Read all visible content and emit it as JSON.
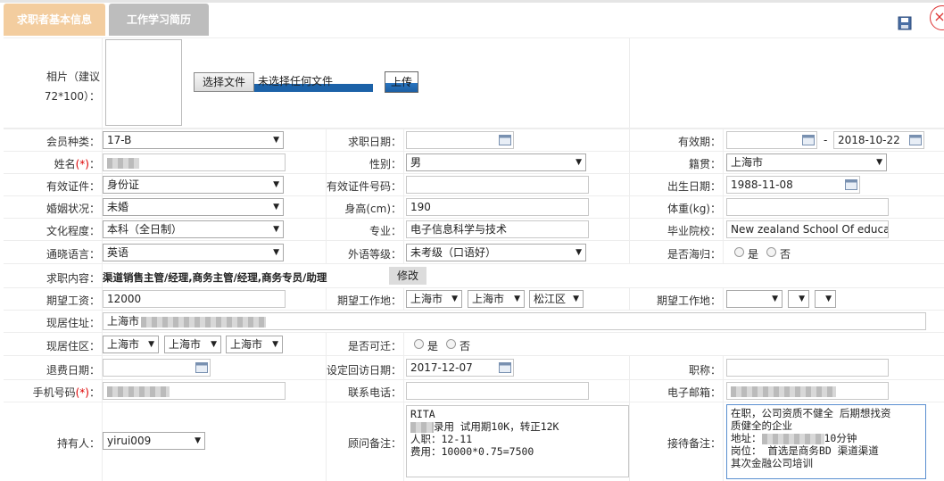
{
  "tabs": [
    {
      "label": "求职者基本信息"
    },
    {
      "label": "工作学习简历"
    }
  ],
  "photo": {
    "label_line1": "相片（建议",
    "label_line2": "72*100）：",
    "choose_file": "选择文件",
    "no_file": "未选择任何文件",
    "upload": "上传"
  },
  "labels": {
    "member_type": "会员种类：",
    "apply_date": "求职日期：",
    "valid_period": "有效期：",
    "dash": "-",
    "name": "姓名",
    "req": "(*)",
    "colon": "：",
    "gender": "性别：",
    "native": "籍贯：",
    "id_type": "有效证件：",
    "id_no": "有效证件号码：",
    "birth": "出生日期：",
    "marital": "婚姻状况：",
    "height": "身高(cm)：",
    "weight": "体重(kg)：",
    "education": "文化程度：",
    "major": "专业：",
    "school": "毕业院校：",
    "language": "通晓语言：",
    "foreign_level": "外语等级：",
    "overseas": "是否海归：",
    "job_content": "求职内容：",
    "modify": "修改",
    "salary": "期望工资：",
    "work_place": "期望工作地：",
    "work_place2": "期望工作地：",
    "address": "现居住址：",
    "district": "现居住区：",
    "relocate": "是否可迁：",
    "refund_date": "退费日期：",
    "revisit_date": "设定回访日期：",
    "title": "职称：",
    "phone": "手机号码",
    "contact": "联系电话：",
    "email": "电子邮箱：",
    "holder": "持有人：",
    "consultant_note": "顾问备注：",
    "reception_note": "接待备注：",
    "yes": "是",
    "no": "否"
  },
  "values": {
    "member_type": "17-B",
    "valid_end": "2018-10-22",
    "gender": "男",
    "native": "上海市",
    "id_type": "身份证",
    "birth": "1988-11-08",
    "marital": "未婚",
    "height": "190",
    "education": "本科（全日制）",
    "major": "电子信息科学与技术",
    "school": "New zealand School Of educati",
    "language": "英语",
    "foreign_level": "未考级（口语好）",
    "job_content": "渠道销售主管/经理,商务主管/经理,商务专员/助理",
    "salary": "12000",
    "wp1": "上海市",
    "wp2": "上海市",
    "wp3": "松江区",
    "address_prefix": "上海市",
    "dist1": "上海市",
    "dist2": "上海市",
    "dist3": "上海市",
    "revisit_date": "2017-12-07",
    "holder": "yirui009"
  },
  "notes": {
    "consultant": [
      "RITA",
      "",
      "录用 试用期10K，转正12K",
      "人职：12-11",
      "费用：10000*0.75=7500"
    ],
    "reception": [
      "在职，公司资质不健全 后期想找资",
      "质健全的企业",
      "地址：",
      "10分钟",
      "岗位：  首选是商务BD 渠道渠道",
      "其次金融公司培训"
    ]
  },
  "icons": [
    "save-icon",
    "close-icon",
    "calendar-icon",
    "chevron-down-icon"
  ]
}
